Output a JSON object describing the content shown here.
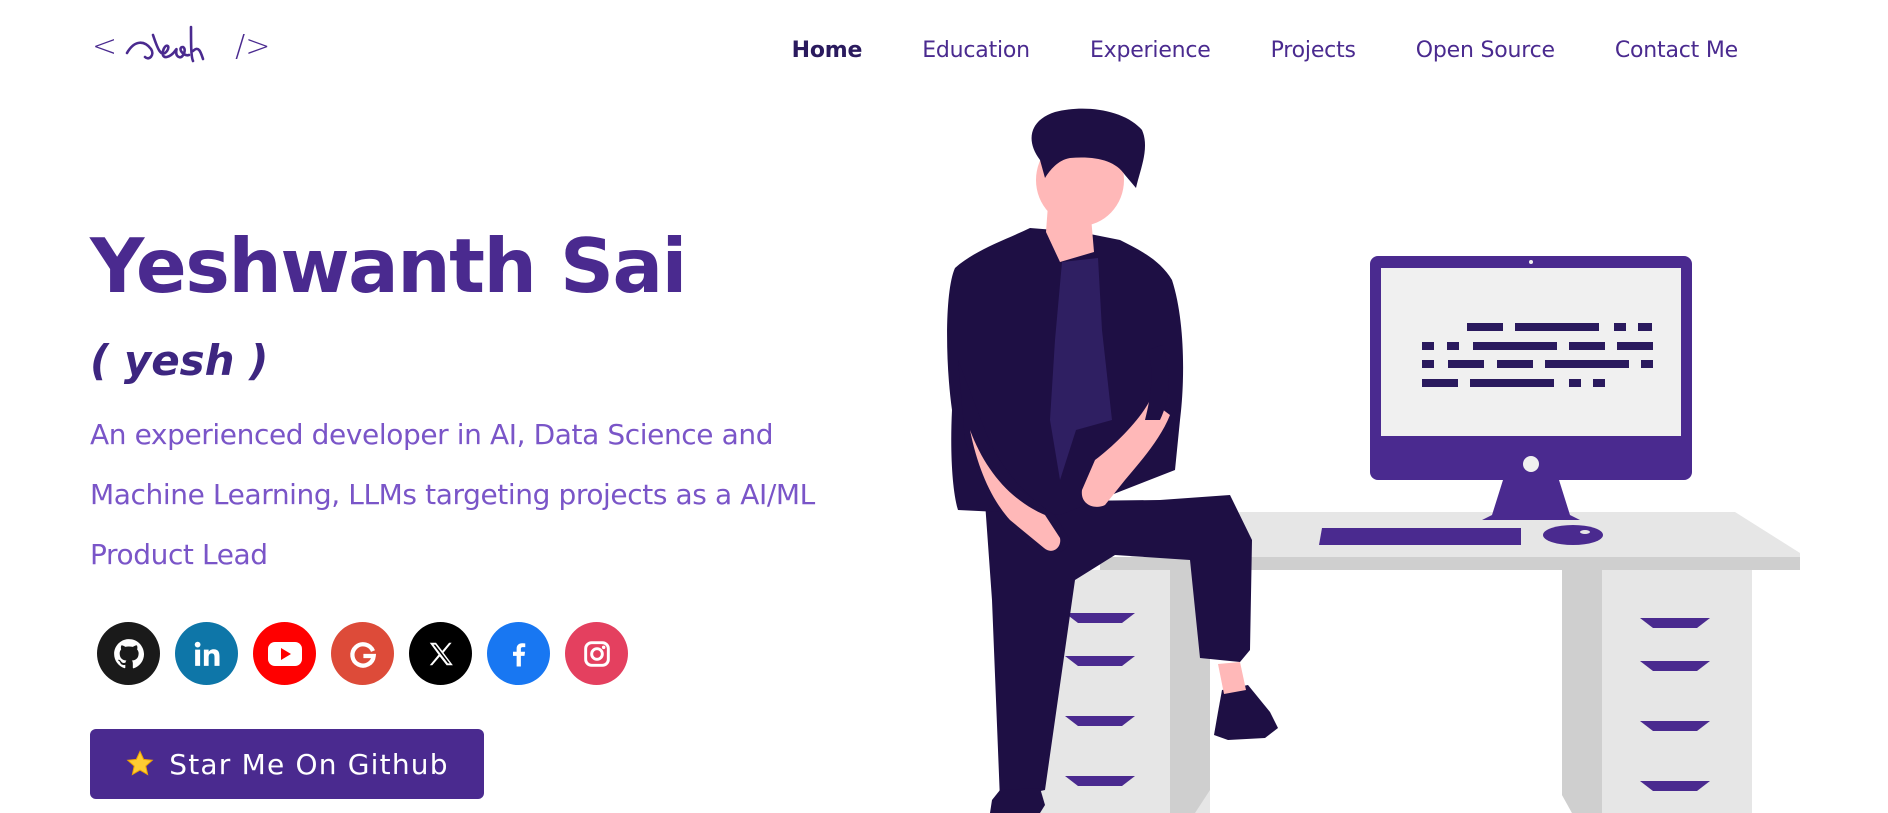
{
  "header": {
    "logo": {
      "left_bracket": "<",
      "signature": "Yesh",
      "right_bracket": "/>"
    },
    "nav": [
      {
        "label": "Home",
        "active": true
      },
      {
        "label": "Education"
      },
      {
        "label": "Experience"
      },
      {
        "label": "Projects"
      },
      {
        "label": "Open Source"
      },
      {
        "label": "Contact Me"
      }
    ]
  },
  "hero": {
    "name": "Yeshwanth Sai",
    "nickname": "( yesh )",
    "description": "An experienced developer in AI, Data Science and Machine Learning, LLMs targeting projects as a AI/ML Product Lead",
    "social": [
      {
        "name": "github",
        "icon": "github-icon",
        "color": "#1a1a1a"
      },
      {
        "name": "linkedin",
        "icon": "linkedin-icon",
        "color": "#0e76a8"
      },
      {
        "name": "youtube",
        "icon": "youtube-icon",
        "color": "#ff0000"
      },
      {
        "name": "google",
        "icon": "google-icon",
        "color": "#dd4b39"
      },
      {
        "name": "x",
        "icon": "x-icon",
        "color": "#000000"
      },
      {
        "name": "facebook",
        "icon": "facebook-icon",
        "color": "#1877f2"
      },
      {
        "name": "instagram",
        "icon": "instagram-icon",
        "color": "#e4405f"
      }
    ],
    "cta": {
      "label": "Star Me On Github",
      "icon": "star-icon"
    }
  },
  "colors": {
    "primary": "#4a2a8f",
    "accent_text": "#7a55c8",
    "dark_figure": "#1e0f44",
    "skin": "#ffb8b8",
    "desk": "#e6e6e6"
  }
}
